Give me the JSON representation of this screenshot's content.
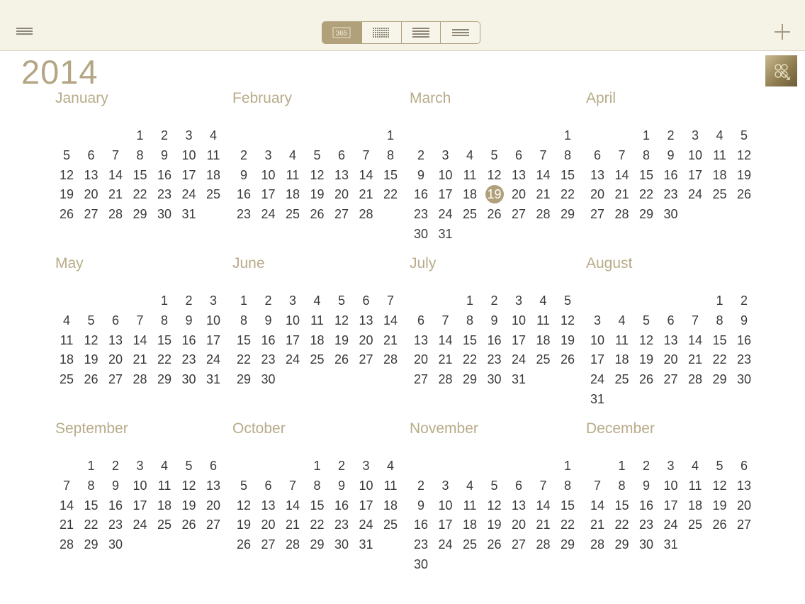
{
  "header": {
    "menu_icon": "menu-icon",
    "views": [
      {
        "name": "year-view",
        "label": "365",
        "icon": "year-365-icon",
        "active": true
      },
      {
        "name": "month-grid-view",
        "icon": "dot-grid-icon",
        "active": false
      },
      {
        "name": "week-list-view",
        "icon": "dense-lines-icon",
        "active": false
      },
      {
        "name": "day-list-view",
        "icon": "lines-icon",
        "active": false
      }
    ],
    "add_icon": "plus-icon"
  },
  "year": "2014",
  "today": {
    "month_index": 2,
    "day": 19
  },
  "colors": {
    "accent": "#b1a17a",
    "month_name": "#b8ab89",
    "year": "#b4a684",
    "day_text": "#3a3a3a",
    "bar": "#f5f3e6"
  },
  "months": [
    {
      "name": "January",
      "first_weekday": 3,
      "days": 31
    },
    {
      "name": "February",
      "first_weekday": 6,
      "days": 28
    },
    {
      "name": "March",
      "first_weekday": 6,
      "days": 31
    },
    {
      "name": "April",
      "first_weekday": 2,
      "days": 30
    },
    {
      "name": "May",
      "first_weekday": 4,
      "days": 31
    },
    {
      "name": "June",
      "first_weekday": 0,
      "days": 30
    },
    {
      "name": "July",
      "first_weekday": 2,
      "days": 31
    },
    {
      "name": "August",
      "first_weekday": 5,
      "days": 31
    },
    {
      "name": "September",
      "first_weekday": 1,
      "days": 30
    },
    {
      "name": "October",
      "first_weekday": 3,
      "days": 31
    },
    {
      "name": "November",
      "first_weekday": 6,
      "days": 30
    },
    {
      "name": "December",
      "first_weekday": 1,
      "days": 31
    }
  ]
}
